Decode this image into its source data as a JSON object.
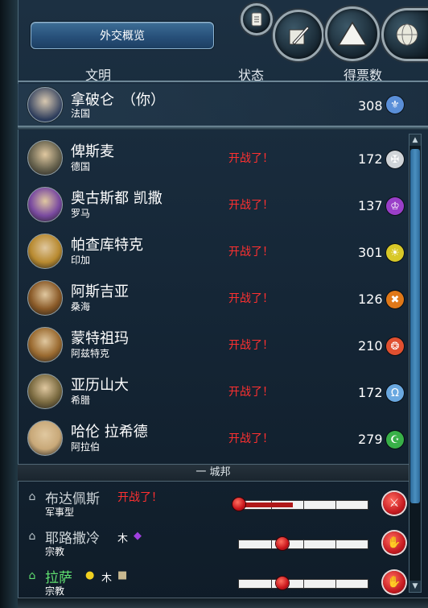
{
  "top_button": {
    "label": "外交概览"
  },
  "header": {
    "civilization": "文明",
    "status": "状态",
    "votes": "得票数"
  },
  "player": {
    "name": "拿破仑　（你）",
    "civ": "法国",
    "votes": "308",
    "icon": "fleur-de-lis-icon",
    "icon_color": "#5a8fd8"
  },
  "leaders": [
    {
      "name": "俾斯麦",
      "civ": "德国",
      "status": "开战了！",
      "votes": "172",
      "icon": "iron-cross-icon",
      "icon_glyph": "✠",
      "icon_color": "#d0d4d8",
      "portrait_color": "#6a6550"
    },
    {
      "name": "奥古斯都 凯撒",
      "civ": "罗马",
      "status": "开战了！",
      "votes": "137",
      "icon": "laurel-wreath-icon",
      "icon_glyph": "♔",
      "icon_color": "#9a3fc8",
      "portrait_color": "#7a4aa0"
    },
    {
      "name": "帕查库特克",
      "civ": "印加",
      "status": "开战了！",
      "votes": "301",
      "icon": "sun-icon",
      "icon_glyph": "☀",
      "icon_color": "#d8c828",
      "portrait_color": "#b88a30"
    },
    {
      "name": "阿斯吉亚",
      "civ": "桑海",
      "status": "开战了！",
      "votes": "126",
      "icon": "songhai-emblem-icon",
      "icon_glyph": "✖",
      "icon_color": "#e07818",
      "portrait_color": "#8a5a28"
    },
    {
      "name": "蒙特祖玛",
      "civ": "阿兹特克",
      "status": "开战了！",
      "votes": "210",
      "icon": "aztec-sun-icon",
      "icon_glyph": "❂",
      "icon_color": "#e05030",
      "portrait_color": "#9a6a30"
    },
    {
      "name": "亚历山大",
      "civ": "希腊",
      "status": "开战了！",
      "votes": "172",
      "icon": "helmet-icon",
      "icon_glyph": "Ω",
      "icon_color": "#6aa8e0",
      "portrait_color": "#7a6a40"
    },
    {
      "name": "哈伦 拉希德",
      "civ": "阿拉伯",
      "status": "开战了！",
      "votes": "279",
      "icon": "crescent-icon",
      "icon_glyph": "☪",
      "icon_color": "#38b048",
      "portrait_color": "#c8a878"
    }
  ],
  "city_state_header": "一 城邦",
  "city_states": [
    {
      "name": "布达佩斯",
      "type": "军事型",
      "status": "开战了！",
      "name_color": "#cfd6da",
      "type_icon": "militaristic-icon",
      "resources": [],
      "influence_marker": 0.0,
      "fill_to": 0.42,
      "action_icon": "crossed-swords-icon",
      "action_glyph": "⚔"
    },
    {
      "name": "耶路撒冷",
      "type": "宗教",
      "status": "",
      "name_color": "#cfd6da",
      "type_icon": "religious-icon",
      "resources": [
        {
          "name": "木",
          "icon": "wood-text-icon"
        },
        {
          "name": "",
          "icon": "purple-gem-icon"
        }
      ],
      "influence_marker": 0.34,
      "fill_to": 0,
      "action_icon": "open-hand-icon",
      "action_glyph": "✋"
    },
    {
      "name": "拉萨",
      "type": "宗教",
      "status": "",
      "name_color": "#60e070",
      "type_icon": "religious-icon",
      "resources": [
        {
          "name": "",
          "icon": "gold-coins-icon"
        },
        {
          "name": "木",
          "icon": "wood-text-icon"
        },
        {
          "name": "",
          "icon": "figure-badge-icon"
        }
      ],
      "influence_marker": 0.34,
      "fill_to": 0,
      "action_icon": "open-hand-icon",
      "action_glyph": "✋"
    }
  ]
}
